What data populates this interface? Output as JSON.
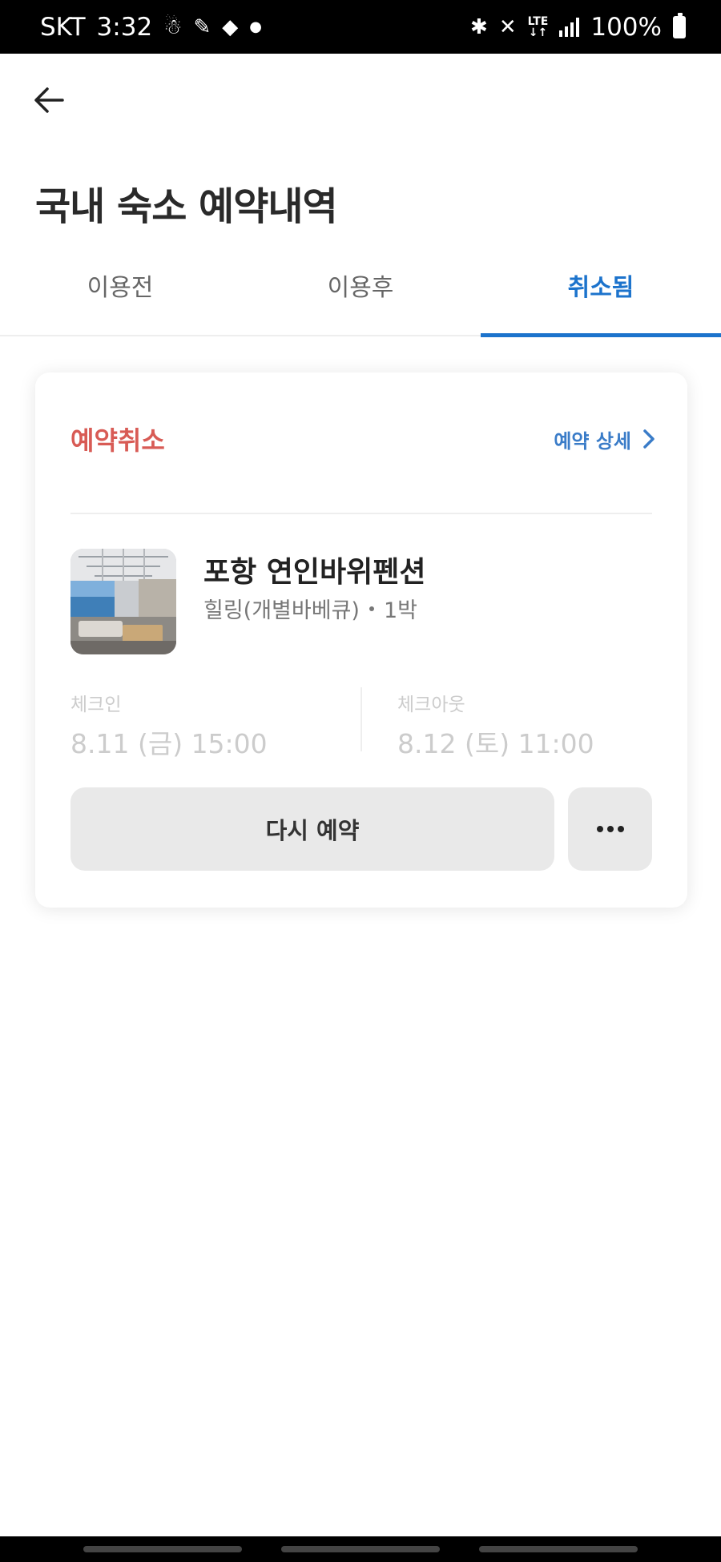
{
  "status_bar": {
    "carrier": "SKT",
    "time": "3:32",
    "network": "LTE",
    "battery": "100%"
  },
  "header": {
    "title": "국내 숙소 예약내역"
  },
  "tabs": [
    {
      "label": "이용전",
      "active": false
    },
    {
      "label": "이용후",
      "active": false
    },
    {
      "label": "취소됨",
      "active": true
    }
  ],
  "reservation": {
    "status": "예약취소",
    "detail_link": "예약 상세",
    "hotel_name": "포항 연인바위펜션",
    "room_type": "힐링(개별바베큐)",
    "nights": "1박",
    "checkin_label": "체크인",
    "checkin_value": "8.11 (금) 15:00",
    "checkout_label": "체크아웃",
    "checkout_value": "8.12 (토) 11:00",
    "rebook_label": "다시 예약"
  },
  "colors": {
    "accent": "#1c73cc",
    "cancel": "#d85b55",
    "link": "#3a7cc8"
  }
}
